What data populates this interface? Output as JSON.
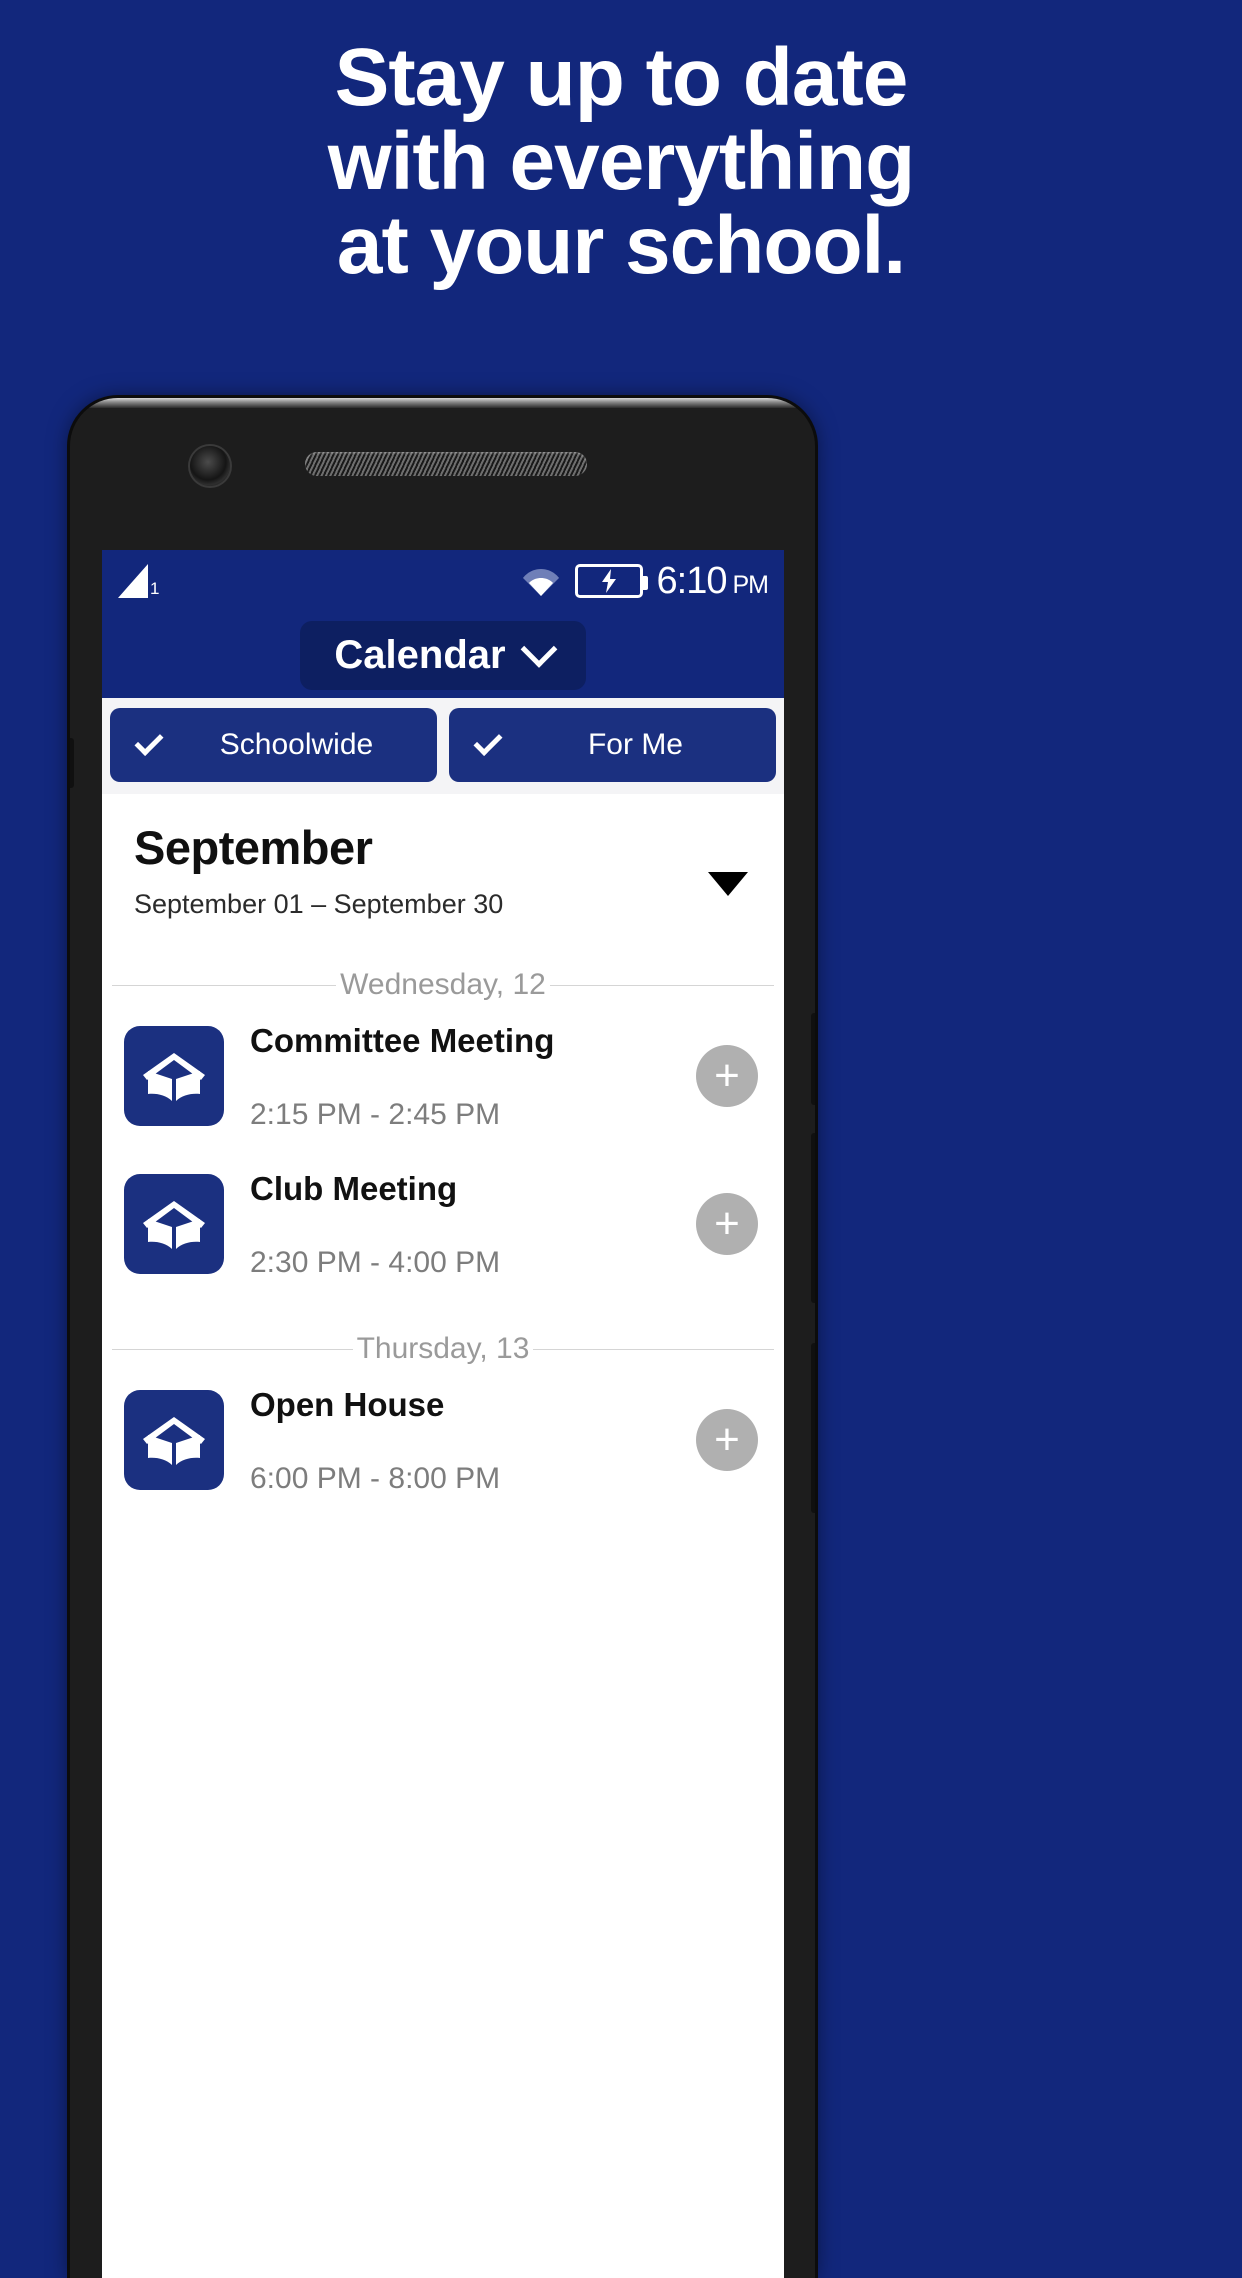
{
  "promo": {
    "lines": [
      "Stay up to date",
      "with everything",
      "at your school."
    ],
    "background_color": "#12277C",
    "text_color": "#FFFFFF"
  },
  "statusbar": {
    "signal_icon": "signal-triangle-icon",
    "signal_badge": "1",
    "wifi_icon": "wifi-icon",
    "battery_icon": "battery-charging-icon",
    "time": "6:10",
    "ampm": "PM",
    "background_color": "#12277C"
  },
  "appbar": {
    "title": "Calendar",
    "dropdown_icon": "chevron-down-icon",
    "background_color": "#12277C",
    "pill_color": "#0D1F61"
  },
  "filters": [
    {
      "label": "Schoolwide",
      "checked": true,
      "icon": "check-icon"
    },
    {
      "label": "For Me",
      "checked": true,
      "icon": "check-icon"
    }
  ],
  "month": {
    "title": "September",
    "range": "September 01 – September 30",
    "caret_icon": "triangle-down-icon"
  },
  "sections": [
    {
      "day_label": "Wednesday, 12",
      "events": [
        {
          "title": "Committee Meeting",
          "time": "2:15 PM - 2:45 PM",
          "icon": "school-book-icon",
          "add_icon": "plus-icon"
        },
        {
          "title": "Club Meeting",
          "time": "2:30 PM - 4:00 PM",
          "icon": "school-book-icon",
          "add_icon": "plus-icon"
        }
      ]
    },
    {
      "day_label": "Thursday, 13",
      "events": [
        {
          "title": "Open House",
          "time": "6:00 PM - 8:00 PM",
          "icon": "school-book-icon",
          "add_icon": "plus-icon"
        }
      ]
    }
  ]
}
